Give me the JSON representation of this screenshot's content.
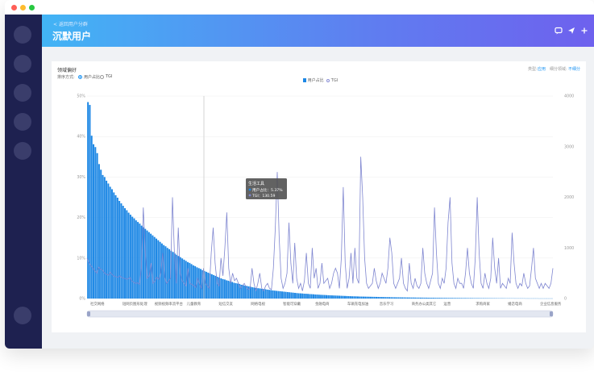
{
  "header": {
    "back_label": "< 返回用户分群",
    "title": "沉默用户"
  },
  "panel": {
    "title": "领域偏好",
    "sort_label": "排序方式:",
    "sort_options": [
      "用户占比",
      "TGI"
    ],
    "type_label": "类型:",
    "type_value": "应用",
    "detail_label": "细分领域:",
    "detail_value": "不细分"
  },
  "legend": [
    "用户占比",
    "TGI"
  ],
  "tooltip": {
    "title": "生活工具",
    "line1": "用户占比：5.37%",
    "line2": "TGI：130.59"
  },
  "chart_data": {
    "type": "bar",
    "x_tick_labels": [
      "社交网络",
      "短网页图形处理",
      "视频视频串流平台",
      "儿童教育",
      "短信交友",
      "网络电视",
      "智能可穿戴",
      "金融电商",
      "车辆充电加油",
      "音乐学习",
      "商务办公类其它",
      "运营",
      "求购商家",
      "婚恋电商",
      "企业信息服务"
    ],
    "y_left": {
      "ticks": [
        "0%",
        "10%",
        "20%",
        "30%",
        "40%",
        "50%"
      ],
      "max": 50
    },
    "y_right": {
      "ticks": [
        "0",
        "1000",
        "2000",
        "3000",
        "4000"
      ],
      "max": 4000
    },
    "series": [
      {
        "name": "用户占比",
        "unit": "%"
      },
      {
        "name": "TGI"
      }
    ],
    "highlight_category": "生活工具",
    "highlight_values": {
      "用户占比": 5.37,
      "TGI": 130.59
    },
    "bar_values": [
      48.5,
      47.8,
      40.2,
      38.1,
      37.4,
      35.9,
      33.2,
      31.8,
      30.5,
      30.0,
      29.1,
      28.4,
      27.6,
      27.0,
      26.2,
      25.5,
      24.9,
      24.1,
      23.5,
      22.9,
      22.3,
      21.8,
      21.2,
      20.7,
      20.2,
      19.8,
      19.3,
      18.9,
      18.5,
      18.0,
      17.6,
      17.2,
      16.8,
      16.4,
      16.0,
      15.6,
      15.2,
      14.8,
      14.4,
      14.0,
      13.6,
      13.2,
      12.9,
      12.5,
      12.2,
      11.8,
      11.5,
      11.1,
      10.8,
      10.5,
      10.2,
      9.9,
      9.6,
      9.3,
      9.0,
      8.8,
      8.5,
      8.2,
      8.0,
      7.7,
      7.5,
      7.3,
      7.0,
      6.8,
      6.6,
      6.4,
      6.2,
      6.0,
      5.8,
      5.6,
      5.37,
      5.2,
      5.0,
      4.8,
      4.7,
      4.5,
      4.4,
      4.2,
      4.1,
      3.9,
      3.8,
      3.7,
      3.6,
      3.4,
      3.3,
      3.2,
      3.1,
      3.0,
      2.9,
      2.8,
      2.7,
      2.6,
      2.55,
      2.5,
      2.4,
      2.35,
      2.3,
      2.2,
      2.15,
      2.1,
      2.0,
      1.95,
      1.9,
      1.85,
      1.8,
      1.75,
      1.7,
      1.65,
      1.6,
      1.55,
      1.5,
      1.45,
      1.4,
      1.35,
      1.3,
      1.28,
      1.25,
      1.2,
      1.18,
      1.15,
      1.1,
      1.08,
      1.05,
      1.0,
      0.98,
      0.95,
      0.92,
      0.9,
      0.88,
      0.85,
      0.82,
      0.8,
      0.78,
      0.76,
      0.74,
      0.72,
      0.7,
      0.68,
      0.66,
      0.64,
      0.62,
      0.6,
      0.58,
      0.56,
      0.55,
      0.54,
      0.52,
      0.5,
      0.49,
      0.48,
      0.47,
      0.46,
      0.45,
      0.44,
      0.43,
      0.42,
      0.41,
      0.4,
      0.39,
      0.38,
      0.37,
      0.36,
      0.35,
      0.34,
      0.33,
      0.32,
      0.31,
      0.3,
      0.3,
      0.29,
      0.28,
      0.28,
      0.27,
      0.26,
      0.26,
      0.25,
      0.25,
      0.24,
      0.23,
      0.23,
      0.22,
      0.22,
      0.21,
      0.21,
      0.2,
      0.2,
      0.19,
      0.19,
      0.18,
      0.18,
      0.17,
      0.17,
      0.16,
      0.16,
      0.15,
      0.15,
      0.15,
      0.14,
      0.14,
      0.14,
      0.13,
      0.13,
      0.13,
      0.12,
      0.12,
      0.12,
      0.11,
      0.11,
      0.11,
      0.1,
      0.1,
      0.1,
      0.1,
      0.09,
      0.09,
      0.09,
      0.09,
      0.08,
      0.08,
      0.08,
      0.08,
      0.07,
      0.07,
      0.07,
      0.07,
      0.07,
      0.06,
      0.06,
      0.06,
      0.06,
      0.06,
      0.05,
      0.05,
      0.05,
      0.05,
      0.05,
      0.05,
      0.04,
      0.04,
      0.04,
      0.04,
      0.04,
      0.04,
      0.04,
      0.03,
      0.03,
      0.03,
      0.03,
      0.03,
      0.03,
      0.03,
      0.03
    ],
    "tgi_values": [
      800,
      700,
      650,
      600,
      550,
      500,
      620,
      580,
      560,
      500,
      480,
      460,
      520,
      470,
      440,
      430,
      420,
      450,
      410,
      400,
      390,
      380,
      420,
      350,
      320,
      300,
      310,
      280,
      600,
      1800,
      900,
      400,
      450,
      700,
      300,
      350,
      420,
      380,
      500,
      900,
      420,
      300,
      350,
      400,
      2000,
      900,
      300,
      1400,
      500,
      350,
      300,
      250,
      600,
      300,
      280,
      250,
      220,
      400,
      280,
      200,
      600,
      300,
      250,
      200,
      900,
      1400,
      700,
      300,
      250,
      800,
      450,
      1000,
      1700,
      600,
      300,
      500,
      350,
      400,
      300,
      200,
      250,
      300,
      220,
      180,
      200,
      600,
      300,
      150,
      300,
      500,
      200,
      150,
      250,
      300,
      200,
      180,
      600,
      1400,
      2500,
      1200,
      400,
      200,
      300,
      500,
      1500,
      700,
      300,
      1100,
      400,
      200,
      300,
      150,
      350,
      900,
      300,
      200,
      1000,
      400,
      600,
      200,
      300,
      700,
      300,
      350,
      400,
      200,
      300,
      500,
      600,
      500,
      200,
      800,
      2200,
      700,
      200,
      400,
      900,
      300,
      1000,
      400,
      300,
      2800,
      2000,
      800,
      300,
      200,
      250,
      300,
      600,
      350,
      200,
      300,
      500,
      400,
      300,
      600,
      1200,
      900,
      300,
      200,
      300,
      400,
      800,
      300,
      200,
      150,
      700,
      300,
      200,
      400,
      250,
      200,
      300,
      1000,
      500,
      300,
      200,
      350,
      500,
      1800,
      900,
      300,
      200,
      400,
      300,
      600,
      1500,
      2000,
      700,
      300,
      200,
      400,
      300,
      300,
      200,
      500,
      1000,
      500,
      300,
      200,
      800,
      2000,
      900,
      300,
      200,
      500,
      300,
      200,
      400,
      1200,
      600,
      300,
      800,
      200,
      300,
      250,
      200,
      400,
      300,
      1300,
      700,
      300,
      200,
      300,
      250,
      500,
      300,
      200,
      250,
      600,
      1000,
      400,
      300,
      200,
      300,
      200,
      300,
      250,
      200,
      300,
      600
    ]
  }
}
